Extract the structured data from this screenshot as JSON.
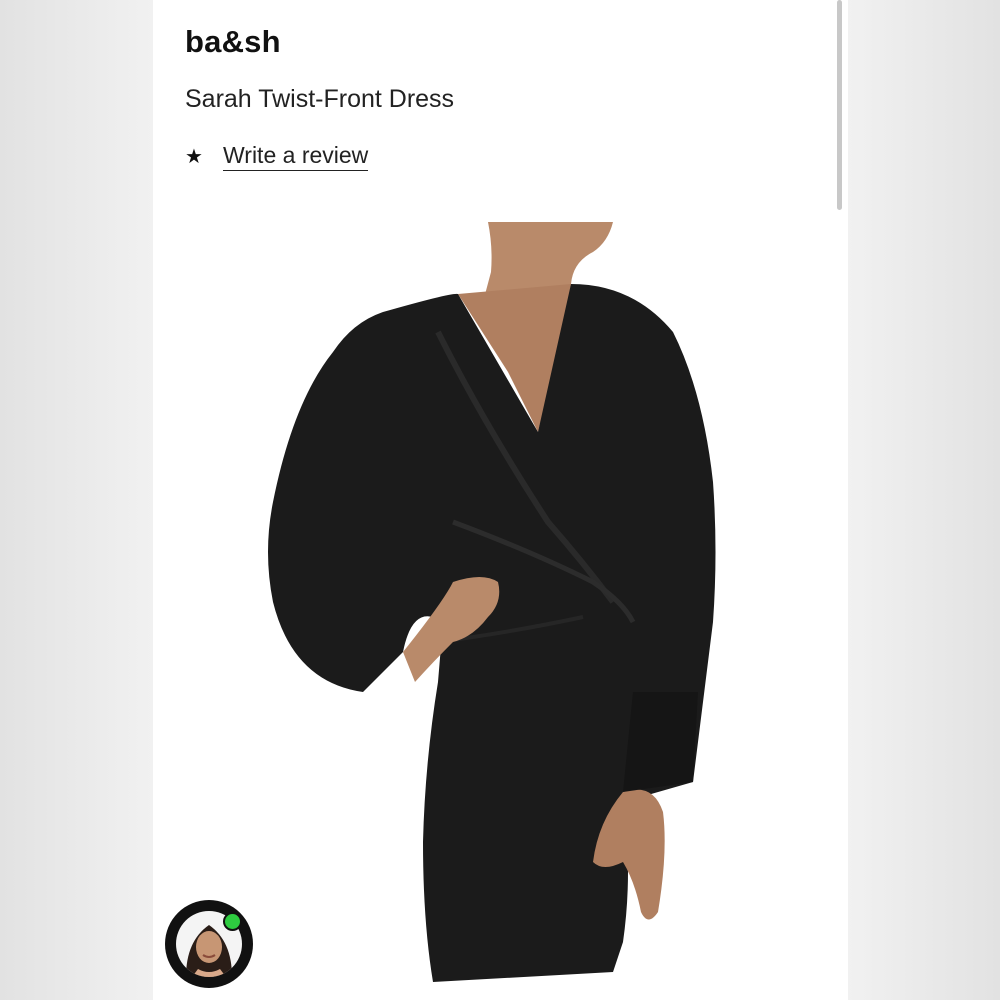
{
  "product": {
    "brand": "ba&sh",
    "name": "Sarah Twist-Front Dress",
    "review_link": "Write a review",
    "rating_icon": "star-icon"
  },
  "photo": {
    "subject": "product-photo-dress"
  },
  "avatar": {
    "status": "online",
    "status_color": "#2ecc40"
  },
  "colors": {
    "dress": "#1b1b1b",
    "skin": "#b98a6a",
    "background": "#ffffff"
  }
}
